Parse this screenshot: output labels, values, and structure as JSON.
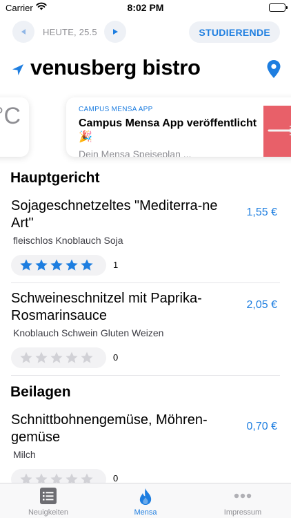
{
  "status_bar": {
    "carrier": "Carrier",
    "time": "8:02 PM",
    "battery_level": 1.0
  },
  "date_nav": {
    "date_label": "HEUTE, 25.5",
    "prev_icon": "triangle-left-icon",
    "next_icon": "triangle-right-icon"
  },
  "role_button": {
    "label": "STUDIERENDE"
  },
  "title": {
    "text": "venusberg bistro",
    "location_icon": "location-arrow-icon",
    "map_icon": "map-pin-icon"
  },
  "carousel": {
    "weather_text": "°C",
    "news_card": {
      "source": "CAMPUS MENSA APP",
      "headline": "Campus Mensa App veröffentlicht 🎉",
      "subtitle": "Dein Mensa Speiseplan ..."
    }
  },
  "sections": [
    {
      "title": "Hauptgericht",
      "dishes": [
        {
          "name": "Sojageschnetzeltes \"Mediterra-ne Art\"",
          "price": "1,55 €",
          "tags": "fleischlos Knoblauch Soja",
          "rating": 5,
          "rating_count": "1"
        },
        {
          "name": "Schweineschnitzel mit Paprika-Rosmarinsauce",
          "price": "2,05 €",
          "tags": "Knoblauch Schwein Gluten Weizen",
          "rating": 0,
          "rating_count": "0"
        }
      ]
    },
    {
      "title": "Beilagen",
      "dishes": [
        {
          "name": "Schnittbohnengemüse, Möhren-gemüse",
          "price": "0,70 €",
          "tags": "Milch",
          "rating": 0,
          "rating_count": "0"
        }
      ]
    }
  ],
  "tab_bar": {
    "tabs": [
      {
        "label": "Neuigkeiten",
        "icon": "list-icon",
        "active": false
      },
      {
        "label": "Mensa",
        "icon": "flame-icon",
        "active": true
      },
      {
        "label": "Impressum",
        "icon": "ellipsis-icon",
        "active": false
      }
    ]
  },
  "colors": {
    "accent": "#1e7ee0",
    "secondary_text": "#8e8e93",
    "star_filled": "#1e7ee0",
    "star_empty": "#d1d1d6"
  }
}
